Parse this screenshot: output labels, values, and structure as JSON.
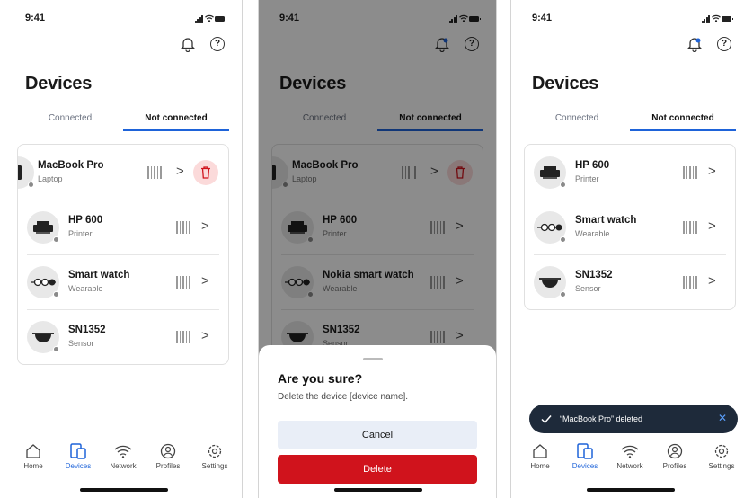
{
  "status": {
    "time": "9:41"
  },
  "page": {
    "title": "Devices"
  },
  "tabs": {
    "connected": "Connected",
    "not_connected": "Not connected"
  },
  "screen1": {
    "devices": [
      {
        "name": "MacBook Pro",
        "type": "Laptop",
        "icon": "laptop-icon"
      },
      {
        "name": "HP 600",
        "type": "Printer",
        "icon": "printer-icon"
      },
      {
        "name": "Smart watch",
        "type": "Wearable",
        "icon": "watch-icon"
      },
      {
        "name": "SN1352",
        "type": "Sensor",
        "icon": "sensor-icon"
      }
    ]
  },
  "screen2": {
    "devices": [
      {
        "name": "MacBook Pro",
        "type": "Laptop"
      },
      {
        "name": "HP 600",
        "type": "Printer"
      },
      {
        "name": "Nokia smart watch",
        "type": "Wearable"
      },
      {
        "name": "SN1352",
        "type": "Sensor"
      }
    ],
    "dialog": {
      "title": "Are you sure?",
      "message": "Delete the device [device name].",
      "cancel": "Cancel",
      "delete": "Delete"
    }
  },
  "screen3": {
    "devices": [
      {
        "name": "HP 600",
        "type": "Printer"
      },
      {
        "name": "Smart watch",
        "type": "Wearable"
      },
      {
        "name": "SN1352",
        "type": "Sensor"
      }
    ],
    "toast": "“MacBook Pro” deleted"
  },
  "nav": {
    "home": "Home",
    "devices": "Devices",
    "network": "Network",
    "profiles": "Profiles",
    "settings": "Settings"
  },
  "colors": {
    "accent": "#1e63d9",
    "danger": "#d0131c",
    "toast_bg": "#1e2a3a"
  }
}
